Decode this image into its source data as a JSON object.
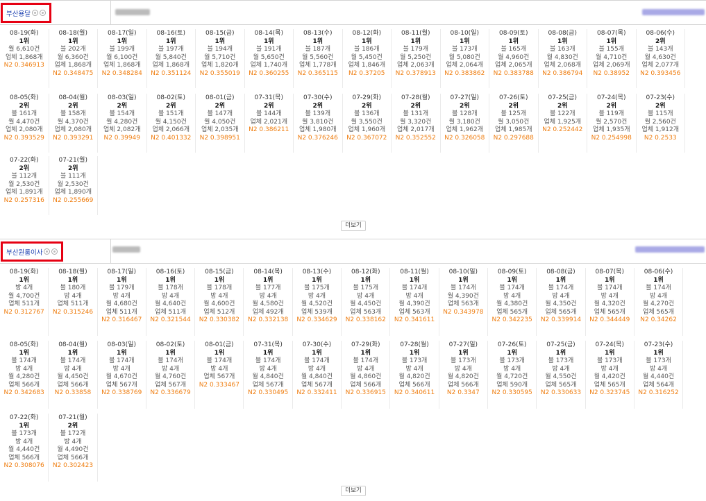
{
  "more_label": "더보기",
  "sections": [
    {
      "shop_name": "부산용달",
      "rows": [
        [
          {
            "date": "08-19(화)",
            "rank": "1위",
            "lines": [
              "월 6,610건",
              "업체 1,868개"
            ],
            "n2": "N2 0.346913",
            "pre": ""
          },
          {
            "date": "08-18(월)",
            "rank": "1위",
            "pre": "블 202개",
            "lines": [
              "월 6,360건",
              "업체 1,868개"
            ],
            "n2": "N2 0.348475"
          },
          {
            "date": "08-17(일)",
            "rank": "1위",
            "pre": "블 199개",
            "lines": [
              "월 6,100건",
              "업체 1,868개"
            ],
            "n2": "N2 0.348284"
          },
          {
            "date": "08-16(토)",
            "rank": "1위",
            "pre": "블 197개",
            "lines": [
              "월 5,840건",
              "업체 1,868개"
            ],
            "n2": "N2 0.351124"
          },
          {
            "date": "08-15(금)",
            "rank": "1위",
            "pre": "블 194개",
            "lines": [
              "월 5,710건",
              "업체 1,820개"
            ],
            "n2": "N2 0.355019"
          },
          {
            "date": "08-14(목)",
            "rank": "1위",
            "pre": "블 191개",
            "lines": [
              "월 5,650건",
              "업체 1,740개"
            ],
            "n2": "N2 0.360255"
          },
          {
            "date": "08-13(수)",
            "rank": "1위",
            "pre": "블 187개",
            "lines": [
              "월 5,560건",
              "업체 1,778개"
            ],
            "n2": "N2 0.365115"
          },
          {
            "date": "08-12(화)",
            "rank": "1위",
            "pre": "블 186개",
            "lines": [
              "월 5,450건",
              "업체 1,846개"
            ],
            "n2": "N2 0.37205"
          },
          {
            "date": "08-11(월)",
            "rank": "1위",
            "pre": "블 179개",
            "lines": [
              "월 5,250건",
              "업체 2,063개"
            ],
            "n2": "N2 0.378913"
          },
          {
            "date": "08-10(일)",
            "rank": "1위",
            "pre": "블 173개",
            "lines": [
              "월 5,080건",
              "업체 2,064개"
            ],
            "n2": "N2 0.383862"
          },
          {
            "date": "08-09(토)",
            "rank": "1위",
            "pre": "블 165개",
            "lines": [
              "월 4,960건",
              "업체 2,065개"
            ],
            "n2": "N2 0.383788"
          },
          {
            "date": "08-08(금)",
            "rank": "1위",
            "pre": "블 163개",
            "lines": [
              "월 4,830건",
              "업체 2,068개"
            ],
            "n2": "N2 0.386794"
          },
          {
            "date": "08-07(목)",
            "rank": "1위",
            "pre": "블 155개",
            "lines": [
              "월 4,710건",
              "업체 2,069개"
            ],
            "n2": "N2 0.38952"
          },
          {
            "date": "08-06(수)",
            "rank": "2위",
            "pre": "블 143개",
            "lines": [
              "월 4,630건",
              "업체 2,077개"
            ],
            "n2": "N2 0.393456"
          }
        ],
        [
          {
            "date": "08-05(화)",
            "rank": "2위",
            "pre": "블 161개",
            "lines": [
              "월 4,470건",
              "업체 2,080개"
            ],
            "n2": "N2 0.393529"
          },
          {
            "date": "08-04(월)",
            "rank": "2위",
            "pre": "블 158개",
            "lines": [
              "월 4,370건",
              "업체 2,080개"
            ],
            "n2": "N2 0.393291"
          },
          {
            "date": "08-03(일)",
            "rank": "2위",
            "pre": "블 154개",
            "lines": [
              "월 4,280건",
              "업체 2,082개"
            ],
            "n2": "N2 0.39949"
          },
          {
            "date": "08-02(토)",
            "rank": "2위",
            "pre": "블 151개",
            "lines": [
              "월 4,150건",
              "업체 2,066개"
            ],
            "n2": "N2 0.401332"
          },
          {
            "date": "08-01(금)",
            "rank": "2위",
            "pre": "블 147개",
            "lines": [
              "월 4,050건",
              "업체 2,035개"
            ],
            "n2": "N2 0.398951"
          },
          {
            "date": "07-31(목)",
            "rank": "2위",
            "pre": "블 144개",
            "lines": [
              "업체 2,021개"
            ],
            "n2": "N2 0.386211"
          },
          {
            "date": "07-30(수)",
            "rank": "2위",
            "pre": "블 139개",
            "lines": [
              "월 3,810건",
              "업체 1,980개"
            ],
            "n2": "N2 0.376246"
          },
          {
            "date": "07-29(화)",
            "rank": "2위",
            "pre": "블 136개",
            "lines": [
              "월 3,550건",
              "업체 1,960개"
            ],
            "n2": "N2 0.367072"
          },
          {
            "date": "07-28(월)",
            "rank": "2위",
            "pre": "블 131개",
            "lines": [
              "월 3,320건",
              "업체 2,017개"
            ],
            "n2": "N2 0.352552"
          },
          {
            "date": "07-27(일)",
            "rank": "2위",
            "pre": "블 128개",
            "lines": [
              "월 3,180건",
              "업체 1,962개"
            ],
            "n2": "N2 0.326058"
          },
          {
            "date": "07-26(토)",
            "rank": "2위",
            "pre": "블 125개",
            "lines": [
              "월 3,050건",
              "업체 1,985개"
            ],
            "n2": "N2 0.297688"
          },
          {
            "date": "07-25(금)",
            "rank": "2위",
            "pre": "블 122개",
            "lines": [
              "업체 1,925개"
            ],
            "n2": "N2 0.252442"
          },
          {
            "date": "07-24(목)",
            "rank": "2위",
            "pre": "블 119개",
            "lines": [
              "월 2,570건",
              "업체 1,935개"
            ],
            "n2": "N2 0.254998"
          },
          {
            "date": "07-23(수)",
            "rank": "2위",
            "pre": "블 115개",
            "lines": [
              "월 2,560건",
              "업체 1,912개"
            ],
            "n2": "N2 0.2533"
          }
        ],
        [
          {
            "date": "07-22(화)",
            "rank": "2위",
            "pre": "블 112개",
            "lines": [
              "월 2,530건",
              "업체 1,891개"
            ],
            "n2": "N2 0.257316"
          },
          {
            "date": "07-21(월)",
            "rank": "2위",
            "pre": "블 111개",
            "lines": [
              "월 2,530건",
              "업체 1,890개"
            ],
            "n2": "N2 0.255669"
          }
        ]
      ]
    },
    {
      "shop_name": "부산원룸이사",
      "rows": [
        [
          {
            "date": "08-19(화)",
            "rank": "1위",
            "pre": "방 4개",
            "lines": [
              "월 4,700건",
              "업체 511개"
            ],
            "n2": "N2 0.312767"
          },
          {
            "date": "08-18(월)",
            "rank": "1위",
            "pre": "블 180개",
            "lines": [
              "방 4개",
              "업체 511개"
            ],
            "n2": "N2 0.315246"
          },
          {
            "date": "08-17(일)",
            "rank": "1위",
            "pre": "블 179개",
            "lines": [
              "방 4개",
              "월 4,680건",
              "업체 511개"
            ],
            "n2": "N2 0.316467"
          },
          {
            "date": "08-16(토)",
            "rank": "1위",
            "pre": "블 178개",
            "lines": [
              "방 4개",
              "월 4,640건",
              "업체 511개"
            ],
            "n2": "N2 0.321544"
          },
          {
            "date": "08-15(금)",
            "rank": "1위",
            "pre": "블 178개",
            "lines": [
              "방 4개",
              "월 4,600건",
              "업체 512개"
            ],
            "n2": "N2 0.330382"
          },
          {
            "date": "08-14(목)",
            "rank": "1위",
            "pre": "블 177개",
            "lines": [
              "방 4개",
              "월 4,580건",
              "업체 492개"
            ],
            "n2": "N2 0.332138"
          },
          {
            "date": "08-13(수)",
            "rank": "1위",
            "pre": "블 175개",
            "lines": [
              "방 4개",
              "월 4,520건",
              "업체 539개"
            ],
            "n2": "N2 0.334629"
          },
          {
            "date": "08-12(화)",
            "rank": "1위",
            "pre": "블 175개",
            "lines": [
              "방 4개",
              "월 4,450건",
              "업체 563개"
            ],
            "n2": "N2 0.338162"
          },
          {
            "date": "08-11(월)",
            "rank": "1위",
            "pre": "블 174개",
            "lines": [
              "방 4개",
              "월 4,390건",
              "업체 563개"
            ],
            "n2": "N2 0.341611"
          },
          {
            "date": "08-10(일)",
            "rank": "1위",
            "pre": "블 174개",
            "lines": [
              "월 4,390건",
              "업체 563개"
            ],
            "n2": "N2 0.343978"
          },
          {
            "date": "08-09(토)",
            "rank": "1위",
            "pre": "블 174개",
            "lines": [
              "방 4개",
              "월 4,380건",
              "업체 565개"
            ],
            "n2": "N2 0.342235"
          },
          {
            "date": "08-08(금)",
            "rank": "1위",
            "pre": "블 174개",
            "lines": [
              "방 4개",
              "월 4,350건",
              "업체 565개"
            ],
            "n2": "N2 0.339914"
          },
          {
            "date": "08-07(목)",
            "rank": "1위",
            "pre": "블 174개",
            "lines": [
              "방 4개",
              "월 4,320건",
              "업체 565개"
            ],
            "n2": "N2 0.344449"
          },
          {
            "date": "08-06(수)",
            "rank": "1위",
            "pre": "블 174개",
            "lines": [
              "방 4개",
              "월 4,270건",
              "업체 565개"
            ],
            "n2": "N2 0.34262"
          }
        ],
        [
          {
            "date": "08-05(화)",
            "rank": "1위",
            "pre": "블 174개",
            "lines": [
              "방 4개",
              "월 4,280건",
              "업체 566개"
            ],
            "n2": "N2 0.342683"
          },
          {
            "date": "08-04(월)",
            "rank": "1위",
            "pre": "블 174개",
            "lines": [
              "방 4개",
              "월 4,450건",
              "업체 566개"
            ],
            "n2": "N2 0.33858"
          },
          {
            "date": "08-03(일)",
            "rank": "1위",
            "pre": "블 174개",
            "lines": [
              "방 4개",
              "월 4,670건",
              "업체 567개"
            ],
            "n2": "N2 0.338769"
          },
          {
            "date": "08-02(토)",
            "rank": "1위",
            "pre": "블 174개",
            "lines": [
              "방 4개",
              "월 4,760건",
              "업체 567개"
            ],
            "n2": "N2 0.336679"
          },
          {
            "date": "08-01(금)",
            "rank": "1위",
            "pre": "블 174개",
            "lines": [
              "방 4개",
              "업체 567개"
            ],
            "n2": "N2 0.333467"
          },
          {
            "date": "07-31(목)",
            "rank": "1위",
            "pre": "블 174개",
            "lines": [
              "방 4개",
              "월 4,840건",
              "업체 567개"
            ],
            "n2": "N2 0.330495"
          },
          {
            "date": "07-30(수)",
            "rank": "1위",
            "pre": "블 174개",
            "lines": [
              "방 4개",
              "월 4,840건",
              "업체 567개"
            ],
            "n2": "N2 0.332411"
          },
          {
            "date": "07-29(화)",
            "rank": "1위",
            "pre": "블 174개",
            "lines": [
              "방 4개",
              "월 4,860건",
              "업체 566개"
            ],
            "n2": "N2 0.336915"
          },
          {
            "date": "07-28(월)",
            "rank": "1위",
            "pre": "블 173개",
            "lines": [
              "방 4개",
              "월 4,820건",
              "업체 566개"
            ],
            "n2": "N2 0.340611"
          },
          {
            "date": "07-27(일)",
            "rank": "1위",
            "pre": "블 173개",
            "lines": [
              "방 4개",
              "월 4,820건",
              "업체 566개"
            ],
            "n2": "N2 0.3347"
          },
          {
            "date": "07-26(토)",
            "rank": "1위",
            "pre": "블 173개",
            "lines": [
              "방 4개",
              "월 4,720건",
              "업체 590개"
            ],
            "n2": "N2 0.330595"
          },
          {
            "date": "07-25(금)",
            "rank": "1위",
            "pre": "블 173개",
            "lines": [
              "방 4개",
              "월 4,550건",
              "업체 565개"
            ],
            "n2": "N2 0.330633"
          },
          {
            "date": "07-24(목)",
            "rank": "1위",
            "pre": "블 173개",
            "lines": [
              "방 4개",
              "월 4,420건",
              "업체 565개"
            ],
            "n2": "N2 0.323745"
          },
          {
            "date": "07-23(수)",
            "rank": "1위",
            "pre": "블 173개",
            "lines": [
              "방 4개",
              "월 4,440건",
              "업체 564개"
            ],
            "n2": "N2 0.316252"
          }
        ],
        [
          {
            "date": "07-22(화)",
            "rank": "1위",
            "pre": "블 173개",
            "lines": [
              "방 4개",
              "월 4,440건",
              "업체 566개"
            ],
            "n2": "N2 0.308076"
          },
          {
            "date": "07-21(월)",
            "rank": "2위",
            "pre": "블 172개",
            "lines": [
              "방 4개",
              "월 4,490건",
              "업체 566개"
            ],
            "n2": "N2 0.302423"
          }
        ]
      ]
    }
  ]
}
